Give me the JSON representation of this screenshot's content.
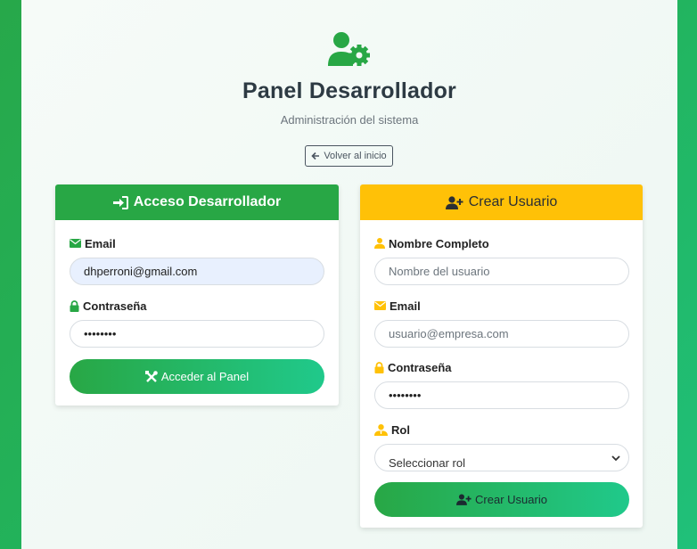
{
  "header": {
    "title": "Panel Desarrollador",
    "subtitle": "Administración del sistema",
    "back_label": "Volver al inicio"
  },
  "login_card": {
    "title": "Acceso Desarrollador",
    "email_label": "Email",
    "email_value": "dhperroni@gmail.com",
    "password_label": "Contraseña",
    "password_value": "••••••••",
    "submit_label": "Acceder al Panel"
  },
  "create_card": {
    "title": "Crear Usuario",
    "name_label": "Nombre Completo",
    "name_placeholder": "Nombre del usuario",
    "email_label": "Email",
    "email_placeholder": "usuario@empresa.com",
    "password_label": "Contraseña",
    "password_value": "••••••••",
    "role_label": "Rol",
    "role_selected": "Seleccionar rol",
    "submit_label": "Crear Usuario"
  },
  "colors": {
    "brand_green": "#28a745",
    "warning_yellow": "#ffc107",
    "title_text": "#2d3a43"
  },
  "icons": {
    "logo": "user-gear-icon",
    "back": "arrow-left-icon",
    "login": "sign-in-icon",
    "email": "envelope-icon",
    "lock": "lock-icon",
    "tools": "tools-icon",
    "user_plus": "user-plus-icon",
    "user": "user-icon",
    "user_tie": "user-tie-icon",
    "chevron": "chevron-down-icon"
  }
}
